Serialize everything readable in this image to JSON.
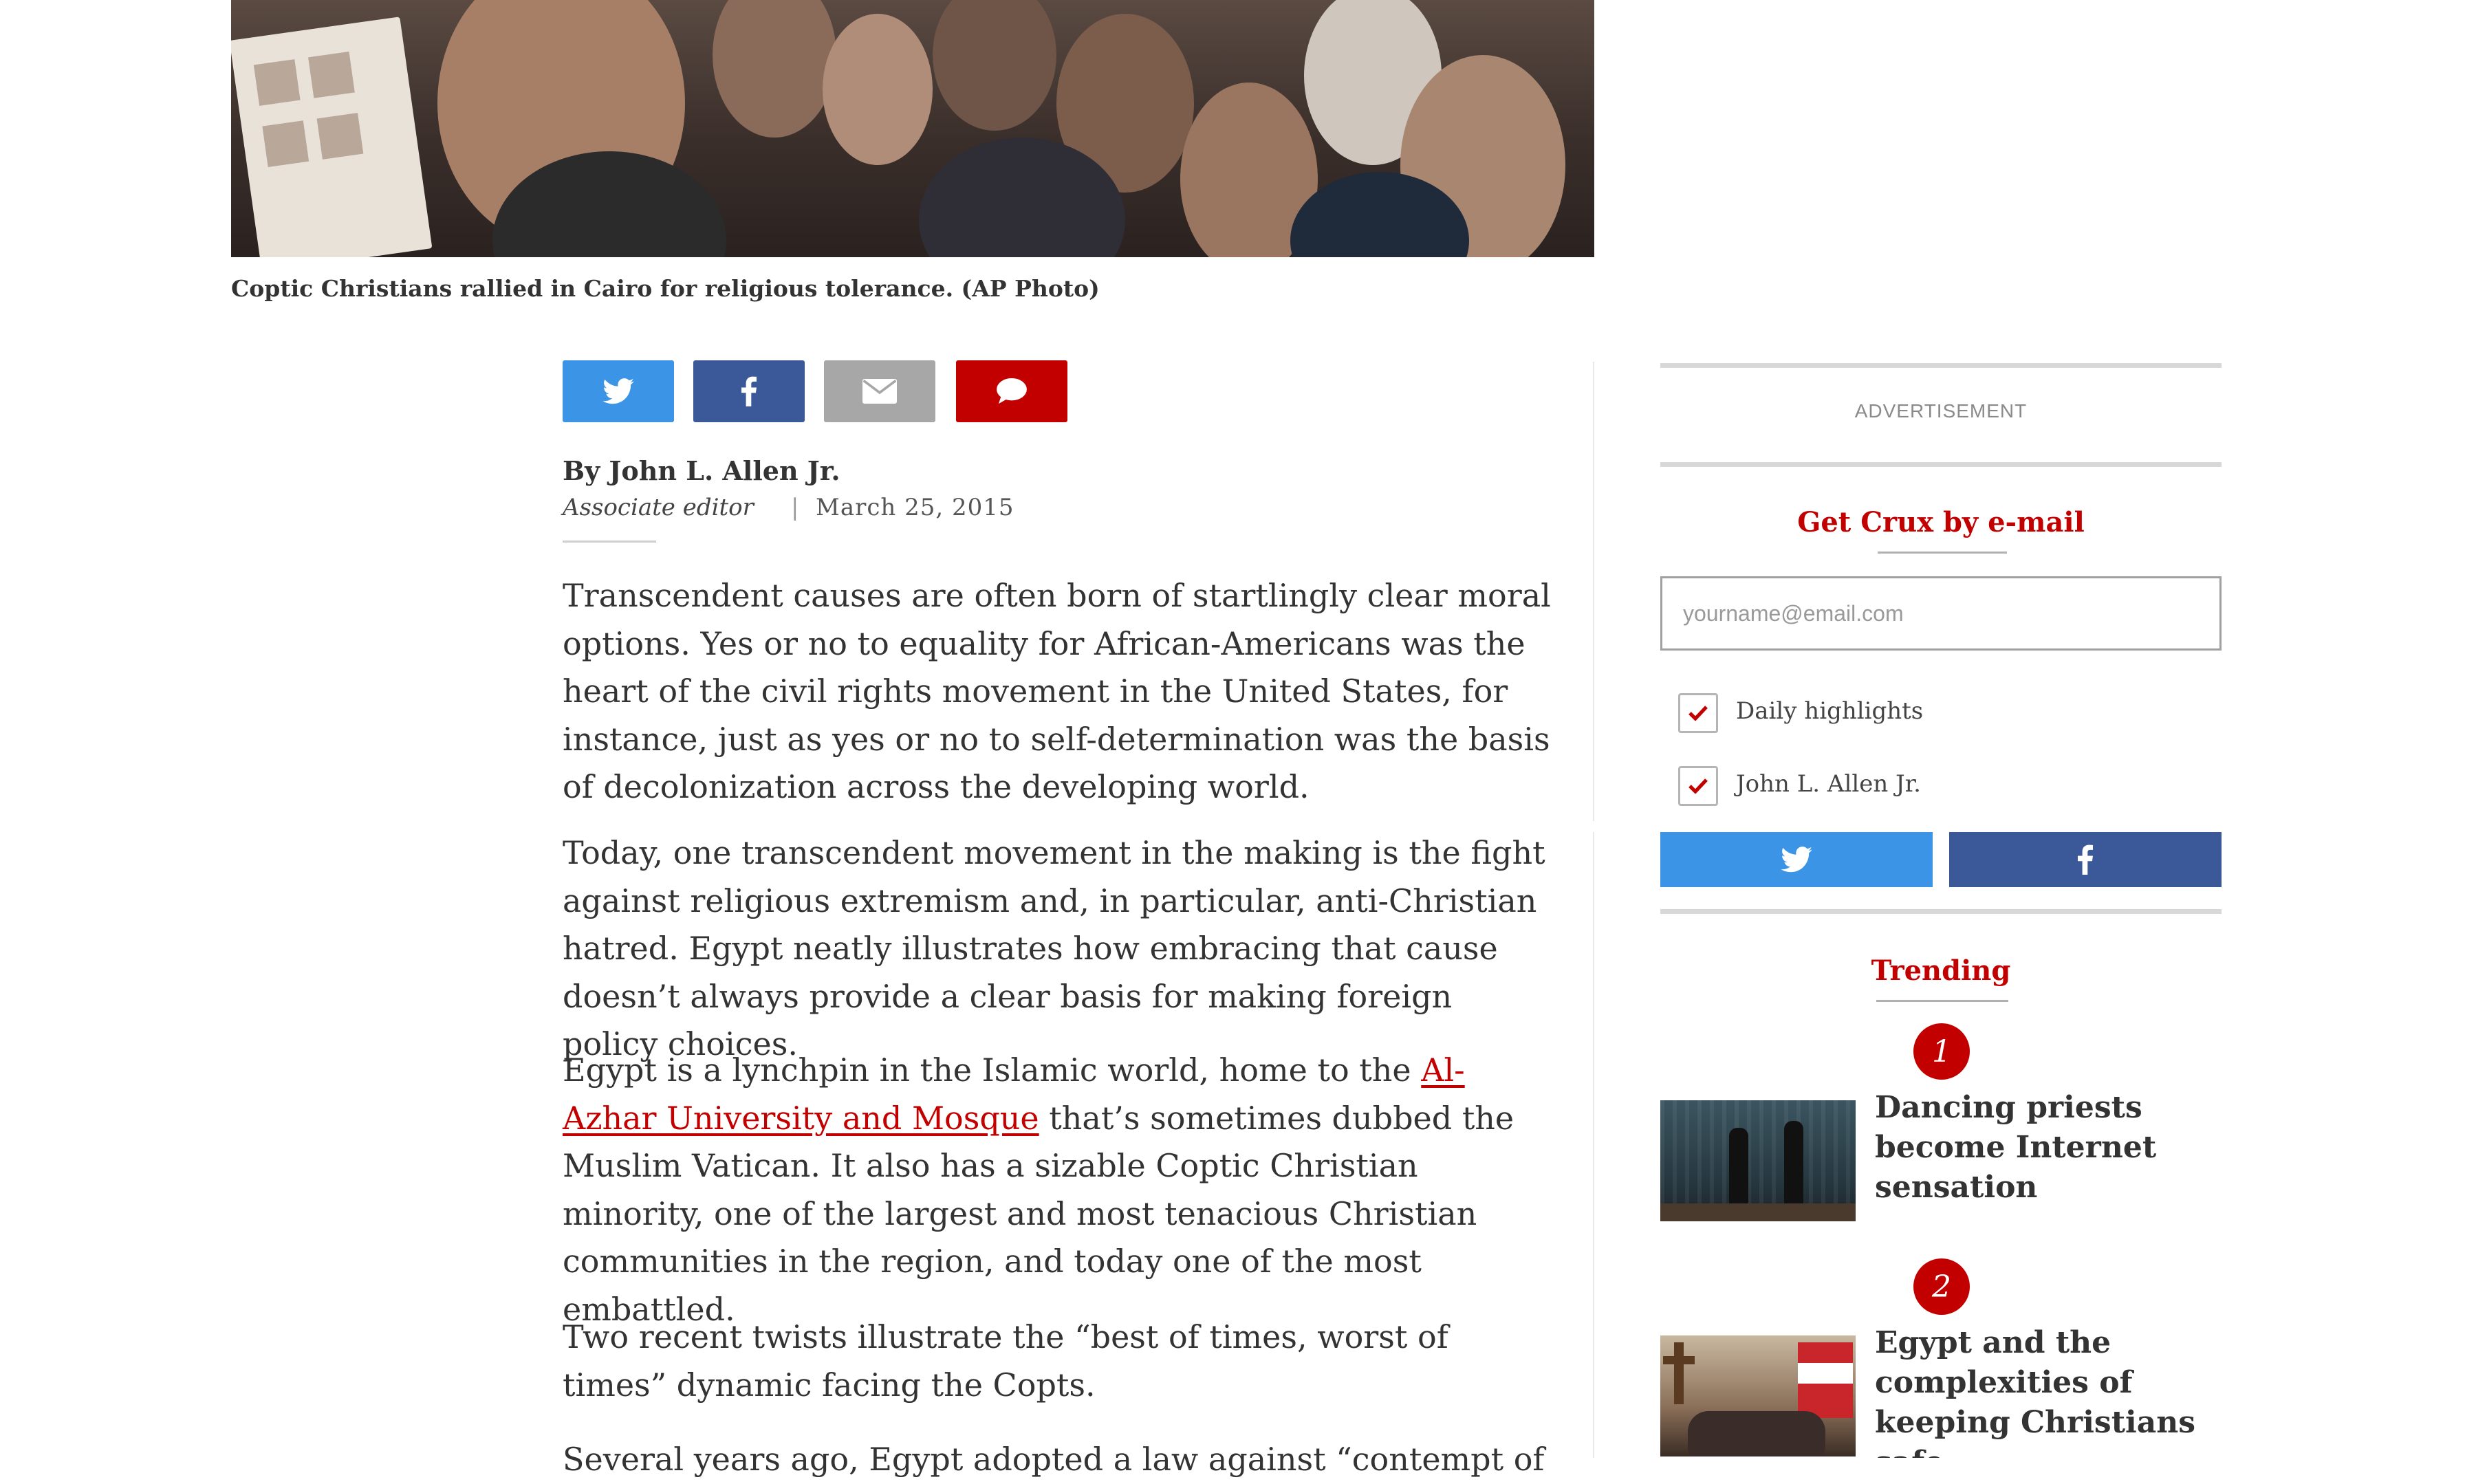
{
  "hero": {
    "caption": "Coptic Christians rallied in Cairo for religious tolerance. (AP Photo)"
  },
  "share": {
    "icons": [
      "twitter-icon",
      "facebook-icon",
      "mail-icon",
      "comment-icon"
    ],
    "colors": {
      "twitter": "#3b94e6",
      "facebook": "#3b5998",
      "email": "#a7a7a7",
      "comment": "#c30000"
    }
  },
  "article": {
    "byline": "By John L. Allen Jr.",
    "role": "Associate editor",
    "separator": "|",
    "date": "March 25, 2015",
    "p1": "Transcendent causes are often born of startlingly clear moral options. Yes or no to equality for African-Americans was the heart of the civil rights movement in the United States, for instance, just as yes or no to self-determination was the basis of decolonization across the developing world.",
    "p2": "Today, one transcendent movement in the making is the fight against religious extremism and, in particular, anti-Christian hatred. Egypt neatly illustrates how embracing that cause doesn’t always provide a clear basis for making foreign policy choices.",
    "p3_before": "Egypt is a lynchpin in the Islamic world, home to the ",
    "p3_link": "Al-Azhar University and Mosque",
    "p3_after": " that’s sometimes dubbed the Muslim Vatican. It also has a sizable Coptic Christian minority, one of the largest and most tenacious Christian communities in the region, and today one of the most embattled.",
    "p4": "Two recent twists illustrate the “best of times, worst of times” dynamic facing the Copts.",
    "p5": "Several years ago, Egypt adopted a law against “contempt of"
  },
  "sidebar": {
    "advertisement": "ADVERTISEMENT",
    "newsletter_title": "Get Crux by e-mail",
    "email_placeholder": "yourname@email.com",
    "options": [
      {
        "label": "Daily highlights",
        "checked": true
      },
      {
        "label": "John L. Allen Jr.",
        "checked": true
      }
    ],
    "trending_title": "Trending",
    "trending": [
      {
        "rank": "1",
        "title": "Dancing priests become Internet sensation"
      },
      {
        "rank": "2",
        "title": "Egypt and the complexities of keeping Christians safe"
      }
    ],
    "accent": "#c30000"
  }
}
